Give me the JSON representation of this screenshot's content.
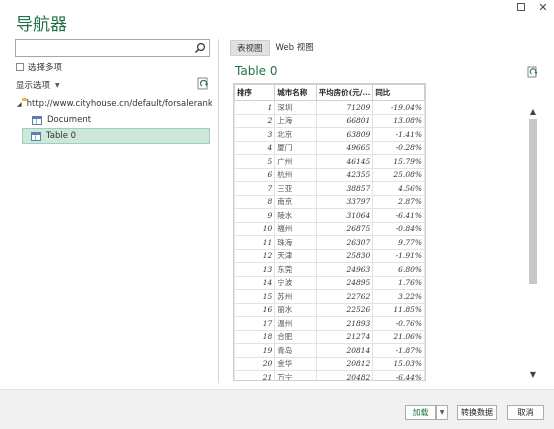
{
  "window": {
    "title": "导航器",
    "close_glyph": "✕"
  },
  "left": {
    "search": {
      "value": "",
      "placeholder": ""
    },
    "multi_select_label": "选择多项",
    "display_options_label": "显示选项",
    "tree": {
      "root_label": "http://www.cityhouse.cn/default/forsalerank.ht...",
      "children": [
        "Document",
        "Table 0"
      ],
      "selected": "Table 0"
    }
  },
  "right": {
    "tabs": [
      "表视图",
      "Web 视图"
    ],
    "active_tab": "表视图",
    "preview_title": "Table 0",
    "table": {
      "columns": [
        "排序",
        "城市名称",
        "平均房价(元/...",
        "同比"
      ],
      "rows": [
        [
          "1",
          "深圳",
          "71209",
          "-19.04%"
        ],
        [
          "2",
          "上海",
          "66801",
          "13.08%"
        ],
        [
          "3",
          "北京",
          "63809",
          "-1.41%"
        ],
        [
          "4",
          "厦门",
          "49665",
          "-0.28%"
        ],
        [
          "5",
          "广州",
          "46145",
          "15.79%"
        ],
        [
          "6",
          "杭州",
          "42355",
          "25.08%"
        ],
        [
          "7",
          "三亚",
          "38857",
          "4.56%"
        ],
        [
          "8",
          "南京",
          "33797",
          "2.87%"
        ],
        [
          "9",
          "陵水",
          "31064",
          "-6.41%"
        ],
        [
          "10",
          "福州",
          "26875",
          "-0.84%"
        ],
        [
          "11",
          "珠海",
          "26307",
          "9.77%"
        ],
        [
          "12",
          "天津",
          "25830",
          "-1.91%"
        ],
        [
          "13",
          "东莞",
          "24963",
          "6.80%"
        ],
        [
          "14",
          "宁波",
          "24895",
          "1.76%"
        ],
        [
          "15",
          "苏州",
          "22762",
          "3.22%"
        ],
        [
          "16",
          "丽水",
          "22526",
          "11.85%"
        ],
        [
          "17",
          "温州",
          "21893",
          "-0.76%"
        ],
        [
          "18",
          "合肥",
          "21274",
          "21.06%"
        ],
        [
          "19",
          "青岛",
          "20814",
          "-1.87%"
        ],
        [
          "20",
          "金华",
          "20812",
          "15.03%"
        ],
        [
          "21",
          "万宁",
          "20482",
          "-6.44%"
        ]
      ]
    }
  },
  "footer": {
    "load_label": "加载",
    "transform_label": "转换数据",
    "cancel_label": "取消"
  },
  "colors": {
    "accent": "#217346",
    "selection": "#cde8da"
  },
  "icons": [
    "minimize-icon",
    "maximize-icon",
    "close-icon",
    "search-icon",
    "refresh-icon",
    "folder-icon",
    "table-icon",
    "chevron-down-icon"
  ]
}
